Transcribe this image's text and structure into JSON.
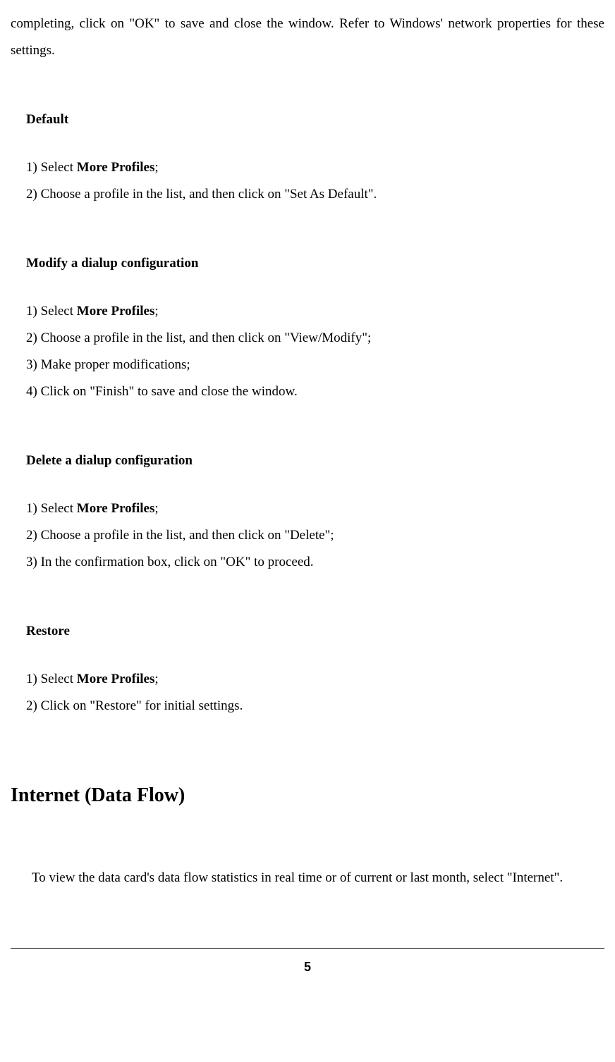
{
  "intro": "completing, click on \"OK\" to save and close the window. Refer to Windows' network properties for these settings.",
  "sections": {
    "default": {
      "title": "Default",
      "step1_prefix": "1) Select ",
      "step1_bold": "More Profiles",
      "step1_suffix": ";",
      "step2": "2) Choose a profile in the list, and then click on \"Set As Default\"."
    },
    "modify": {
      "title": "Modify a dialup configuration",
      "step1_prefix": "1) Select ",
      "step1_bold": "More Profiles",
      "step1_suffix": ";",
      "step2": "2) Choose a profile in the list, and then click on \"View/Modify\";",
      "step3": "3) Make proper modifications;",
      "step4": "4) Click on \"Finish\" to save and close the window."
    },
    "delete": {
      "title": "Delete a dialup configuration",
      "step1_prefix": "1) Select ",
      "step1_bold": "More Profiles",
      "step1_suffix": ";",
      "step2": "2) Choose a profile in the list, and then click on \"Delete\";",
      "step3": "3) In the confirmation box, click on \"OK\" to proceed."
    },
    "restore": {
      "title": "Restore",
      "step1_prefix": "1) Select ",
      "step1_bold": "More Profiles",
      "step1_suffix": ";",
      "step2": "2) Click on \"Restore\" for initial settings."
    }
  },
  "mainHeading": "Internet (Data Flow)",
  "bodyText": "To view the data card's data flow statistics in real time or of current or last month, select \"Internet\".",
  "pageNumber": "5"
}
